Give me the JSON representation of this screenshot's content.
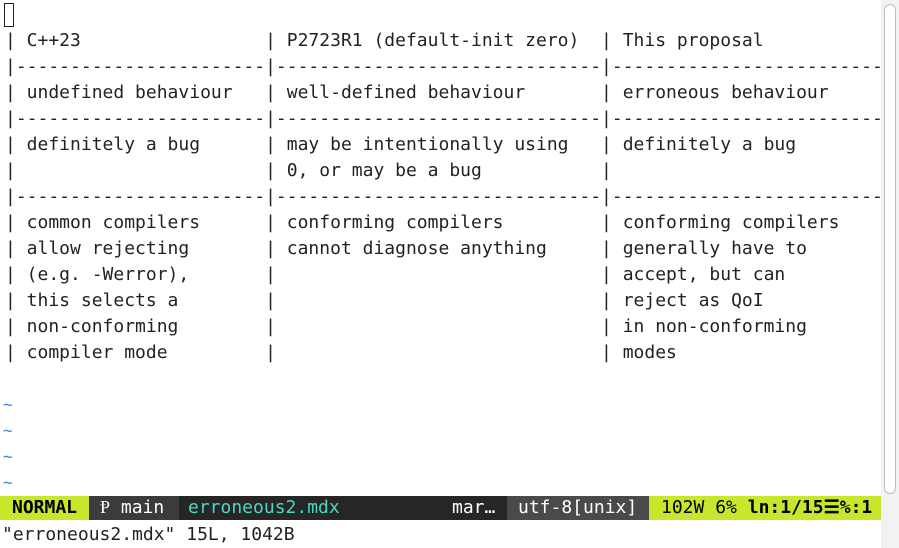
{
  "editor": {
    "lines": [
      "| C++23                 | P2723R1 (default-init zero)  | This proposal           |",
      "|-----------------------|------------------------------|-------------------------|",
      "| undefined behaviour   | well-defined behaviour       | erroneous behaviour     |",
      "|-----------------------|------------------------------|-------------------------|",
      "| definitely a bug      | may be intentionally using   | definitely a bug        |",
      "|                       | 0, or may be a bug           |                         |",
      "|-----------------------|------------------------------|-------------------------|",
      "| common compilers      | conforming compilers         | conforming compilers    |",
      "| allow rejecting       | cannot diagnose anything     | generally have to       |",
      "| (e.g. -Werror),       |                              | accept, but can         |",
      "| this selects a        |                              | reject as QoI           |",
      "| non-conforming        |                              | in non-conforming       |",
      "| compiler mode         |                              | modes                   |",
      ""
    ],
    "tilde": "~"
  },
  "statusline": {
    "mode": "NORMAL",
    "branch_icon": "branch-icon",
    "branch_glyph": "Ᵽ",
    "branch": "main",
    "filename": "erroneous2.mdx",
    "filetype": "mar…",
    "encoding": "utf-8[unix]",
    "words": "102W",
    "percent": "6%",
    "position_prefix": "ln",
    "position": ":1/15",
    "column_glyph": "☰",
    "column": "%:1"
  },
  "cmdline": {
    "message": "\"erroneous2.mdx\" 15L, 1042B"
  },
  "colors": {
    "mode_bg": "#c8e62b",
    "filename_fg": "#4ed6c0",
    "tilde_fg": "#3d7fd9"
  }
}
